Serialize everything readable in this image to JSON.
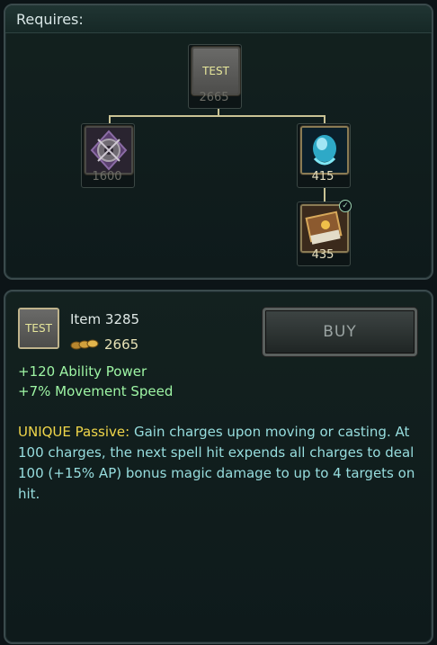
{
  "requires_label": "Requires:",
  "tree": {
    "root": {
      "icon_text": "TEST",
      "price": "2665"
    },
    "left": {
      "icon": "dark-gear-crest-icon",
      "price": "1600"
    },
    "right": {
      "icon": "blue-crystal-orb-icon",
      "price": "415"
    },
    "right_child": {
      "icon": "spell-book-icon",
      "price": "435",
      "owned": true
    }
  },
  "item": {
    "icon_text": "TEST",
    "name": "Item 3285",
    "price": "2665",
    "buy_label": "BUY",
    "stats": [
      "+120 Ability Power",
      "+7% Movement Speed"
    ],
    "unique_label": "UNIQUE Passive:",
    "description": " Gain charges upon moving or casting. At 100 charges, the next spell hit expends all charges to deal 100 (+15% AP) bonus magic damage to up to 4 targets on hit."
  },
  "colors": {
    "stat_green": "#9ef5a4",
    "desc_cyan": "#97ddde",
    "unique_gold": "#f0d64a"
  }
}
